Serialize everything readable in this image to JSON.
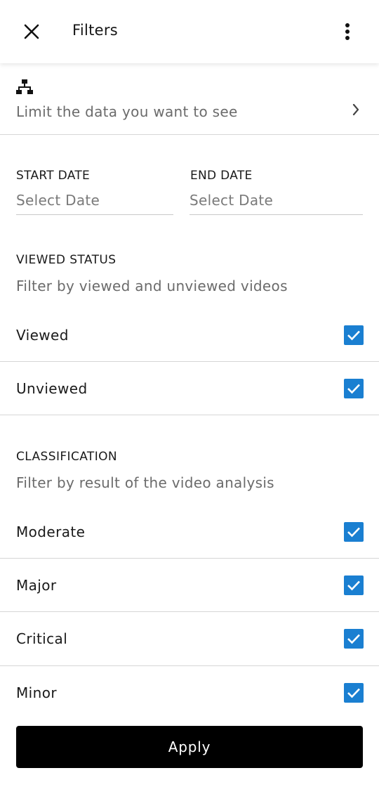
{
  "header": {
    "title": "Filters",
    "close_icon": "close-icon",
    "more_icon": "more-vertical-icon"
  },
  "limit": {
    "text": "Limit the data you want to see",
    "icon": "hierarchy-icon",
    "chevron": "chevron-right-icon"
  },
  "dates": {
    "start_label": "START DATE",
    "start_value": "Select Date",
    "end_label": "END DATE",
    "end_value": "Select Date"
  },
  "viewed_status": {
    "label": "VIEWED STATUS",
    "subtitle": "Filter by viewed and unviewed videos",
    "options": [
      {
        "label": "Viewed",
        "checked": true
      },
      {
        "label": "Unviewed",
        "checked": true
      }
    ]
  },
  "classification": {
    "label": "CLASSIFICATION",
    "subtitle": "Filter by result of the video analysis",
    "options": [
      {
        "label": "Moderate",
        "checked": true
      },
      {
        "label": "Major",
        "checked": true
      },
      {
        "label": "Critical",
        "checked": true
      },
      {
        "label": "Minor",
        "checked": true
      }
    ]
  },
  "apply_label": "Apply",
  "colors": {
    "checkbox": "#1a7fd1",
    "apply_bg": "#000000"
  }
}
